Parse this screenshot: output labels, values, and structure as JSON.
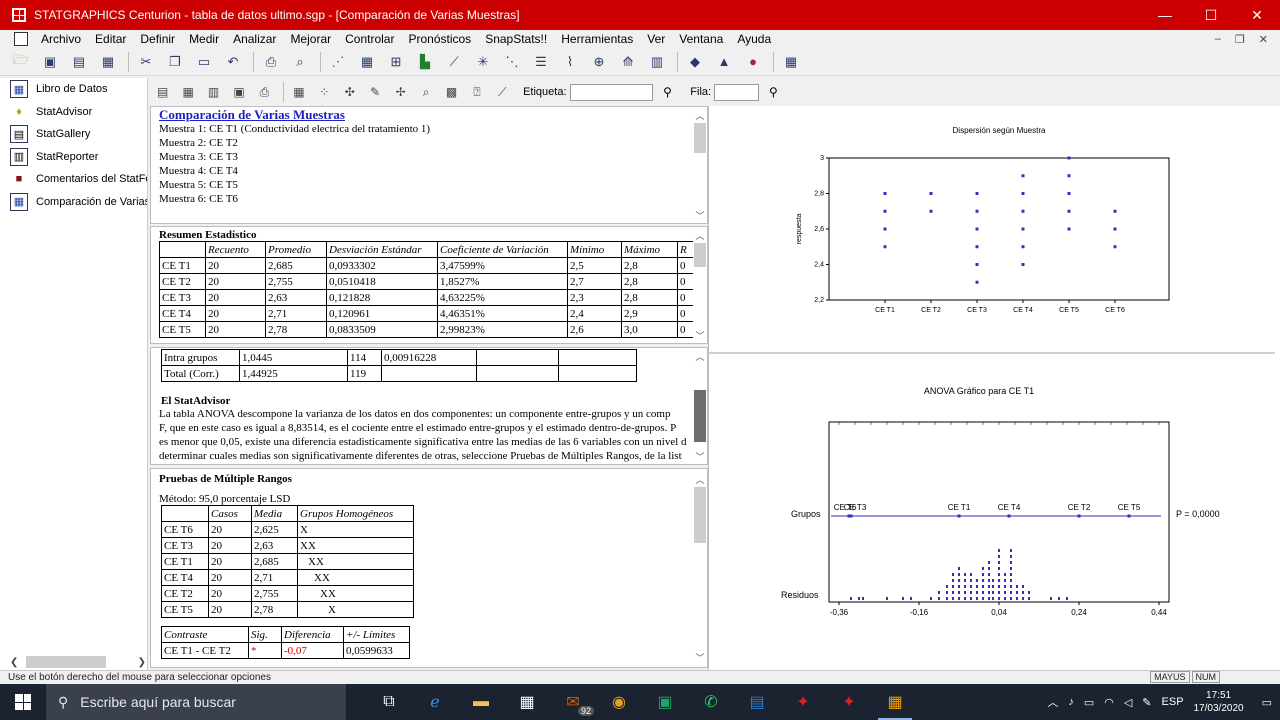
{
  "window": {
    "title": "STATGRAPHICS Centurion - tabla de datos ultimo.sgp - [Comparación de Varias Muestras]",
    "min": "—",
    "max": "☐",
    "close": "✕"
  },
  "menu": [
    "Archivo",
    "Editar",
    "Definir",
    "Medir",
    "Analizar",
    "Mejorar",
    "Controlar",
    "Pronósticos",
    "SnapStats!!",
    "Herramientas",
    "Ver",
    "Ventana",
    "Ayuda"
  ],
  "mdi_controls": [
    "–",
    "❐",
    "✕"
  ],
  "sidebar": {
    "items": [
      {
        "label": "Libro de Datos",
        "icon": "▦"
      },
      {
        "label": "StatAdvisor",
        "icon": "♦"
      },
      {
        "label": "StatGallery",
        "icon": "▤"
      },
      {
        "label": "StatReporter",
        "icon": "▥"
      },
      {
        "label": "Comentarios del StatFolio",
        "icon": "■"
      },
      {
        "label": "Comparación de Varias Muestras",
        "icon": "▦"
      }
    ]
  },
  "toolbar2": {
    "etiqueta_label": "Etiqueta:",
    "fila_label": "Fila:"
  },
  "summary_pane": {
    "title": "Comparación de Varias Muestras",
    "lines": [
      "Muestra 1: CE T1 (Conductividad electrica del tratamiento 1)",
      "Muestra 2: CE T2",
      "Muestra 3: CE T3",
      "Muestra 4: CE T4",
      "Muestra 5: CE T5",
      "Muestra 6: CE T6"
    ]
  },
  "resumen": {
    "title": "Resumen Estadístico",
    "headers": [
      "",
      "Recuento",
      "Promedio",
      "Desviación Estándar",
      "Coeficiente de Variación",
      "Mínimo",
      "Máximo",
      "R"
    ],
    "rows": [
      [
        "CE T1",
        "20",
        "2,685",
        "0,0933302",
        "3,47599%",
        "2,5",
        "2,8",
        "0"
      ],
      [
        "CE T2",
        "20",
        "2,755",
        "0,0510418",
        "1,8527%",
        "2,7",
        "2,8",
        "0"
      ],
      [
        "CE T3",
        "20",
        "2,63",
        "0,121828",
        "4,63225%",
        "2,3",
        "2,8",
        "0"
      ],
      [
        "CE T4",
        "20",
        "2,71",
        "0,120961",
        "4,46351%",
        "2,4",
        "2,9",
        "0"
      ],
      [
        "CE T5",
        "20",
        "2,78",
        "0,0833509",
        "2,99823%",
        "2,6",
        "3,0",
        "0"
      ]
    ]
  },
  "anova_pane": {
    "rows": [
      [
        "Intra grupos",
        "1,0445",
        "114",
        "0,00916228",
        "",
        ""
      ],
      [
        "Total (Corr.)",
        "1,44925",
        "119",
        "",
        "",
        ""
      ]
    ],
    "advisor_title": "El StatAdvisor",
    "advisor_lines": [
      "La tabla ANOVA descompone la varianza de los datos en dos componentes: un componente entre-grupos y un comp",
      "F, que en este caso es igual a 8,83514, es el cociente entre el estimado entre-grupos y el estimado dentro-de-grupos.  P",
      "es menor que 0,05, existe una diferencia estadisticamente significativa entre las medias de las 6 variables con un nivel d",
      "determinar cuales medias son significativamente diferentes de otras, seleccione Pruebas de Múltiples Rangos, de la list"
    ]
  },
  "rangos_pane": {
    "title": "Pruebas de Múltiple Rangos",
    "metodo": "Método: 95,0 porcentaje LSD",
    "headers": [
      "",
      "Casos",
      "Media",
      "Grupos Homogéneos"
    ],
    "rows": [
      [
        "CE T6",
        "20",
        "2,625",
        "X"
      ],
      [
        "CE T3",
        "20",
        "2,63",
        "XX"
      ],
      [
        "CE T1",
        "20",
        "2,685",
        "XX"
      ],
      [
        "CE T4",
        "20",
        "2,71",
        "XX"
      ],
      [
        "CE T2",
        "20",
        "2,755",
        "XX"
      ],
      [
        "CE T5",
        "20",
        "2,78",
        "X"
      ]
    ],
    "contrast_headers": [
      "Contraste",
      "Sig.",
      "Diferencia",
      "+/- Límites"
    ],
    "contrast_row": [
      "CE T1 - CE T2",
      "*",
      "-0,07",
      "0,0599633"
    ]
  },
  "chart_data": [
    {
      "type": "scatter",
      "title": "Dispersión según Muestra",
      "ylabel": "respuesta",
      "categories": [
        "CE T1",
        "CE T2",
        "CE T3",
        "CE T4",
        "CE T5",
        "CE T6"
      ],
      "ylim": [
        2.2,
        3.0
      ],
      "yticks": [
        "2,2",
        "2,4",
        "2,6",
        "2,8",
        "3"
      ],
      "color": "#3030c0",
      "series": [
        {
          "values": [
            2.5,
            2.6,
            2.7,
            2.8
          ]
        },
        {
          "values": [
            2.7,
            2.8
          ]
        },
        {
          "values": [
            2.3,
            2.4,
            2.5,
            2.6,
            2.7,
            2.8
          ]
        },
        {
          "values": [
            2.4,
            2.5,
            2.6,
            2.7,
            2.8,
            2.9
          ]
        },
        {
          "values": [
            2.6,
            2.7,
            2.8,
            2.9,
            3.0
          ]
        },
        {
          "values": [
            2.5,
            2.6,
            2.7
          ]
        }
      ]
    },
    {
      "type": "scatter",
      "title": "ANOVA Gráfico para CE T1",
      "row_labels": [
        "Grupos",
        "Residuos"
      ],
      "p_label": "P = 0,0000",
      "xlim": [
        -0.36,
        0.44
      ],
      "xticks": [
        "-0,36",
        "-0,16",
        "0,04",
        "0,24",
        "0,44"
      ],
      "color": "#3030c0",
      "groups": [
        {
          "name": "CE T6",
          "x": -0.335
        },
        {
          "name": "CE T3",
          "x": -0.33
        },
        {
          "name": "CE T1",
          "x": -0.06
        },
        {
          "name": "CE T4",
          "x": 0.065
        },
        {
          "name": "CE T2",
          "x": 0.24
        },
        {
          "name": "CE T5",
          "x": 0.365
        }
      ],
      "residuals": [
        {
          "x": -0.33,
          "n": 1
        },
        {
          "x": -0.31,
          "n": 1
        },
        {
          "x": -0.3,
          "n": 1
        },
        {
          "x": -0.24,
          "n": 1
        },
        {
          "x": -0.2,
          "n": 1
        },
        {
          "x": -0.18,
          "n": 1
        },
        {
          "x": -0.13,
          "n": 1
        },
        {
          "x": -0.11,
          "n": 2
        },
        {
          "x": -0.09,
          "n": 3
        },
        {
          "x": -0.075,
          "n": 5
        },
        {
          "x": -0.06,
          "n": 6
        },
        {
          "x": -0.045,
          "n": 5
        },
        {
          "x": -0.03,
          "n": 5
        },
        {
          "x": -0.015,
          "n": 4
        },
        {
          "x": 0.0,
          "n": 6
        },
        {
          "x": 0.015,
          "n": 7
        },
        {
          "x": 0.025,
          "n": 4
        },
        {
          "x": 0.04,
          "n": 9
        },
        {
          "x": 0.055,
          "n": 5
        },
        {
          "x": 0.07,
          "n": 9
        },
        {
          "x": 0.085,
          "n": 3
        },
        {
          "x": 0.1,
          "n": 3
        },
        {
          "x": 0.115,
          "n": 2
        },
        {
          "x": 0.17,
          "n": 1
        },
        {
          "x": 0.19,
          "n": 1
        },
        {
          "x": 0.21,
          "n": 1
        }
      ]
    }
  ],
  "statusbar": {
    "text": "Use el botón derecho del mouse para seleccionar opciones",
    "indicators": [
      "MAYUS",
      "NUM"
    ]
  },
  "taskbar": {
    "search_placeholder": "Escribe aquí para buscar",
    "mail_badge": "92",
    "lang": "ESP",
    "time": "17:51",
    "date": "17/03/2020"
  }
}
